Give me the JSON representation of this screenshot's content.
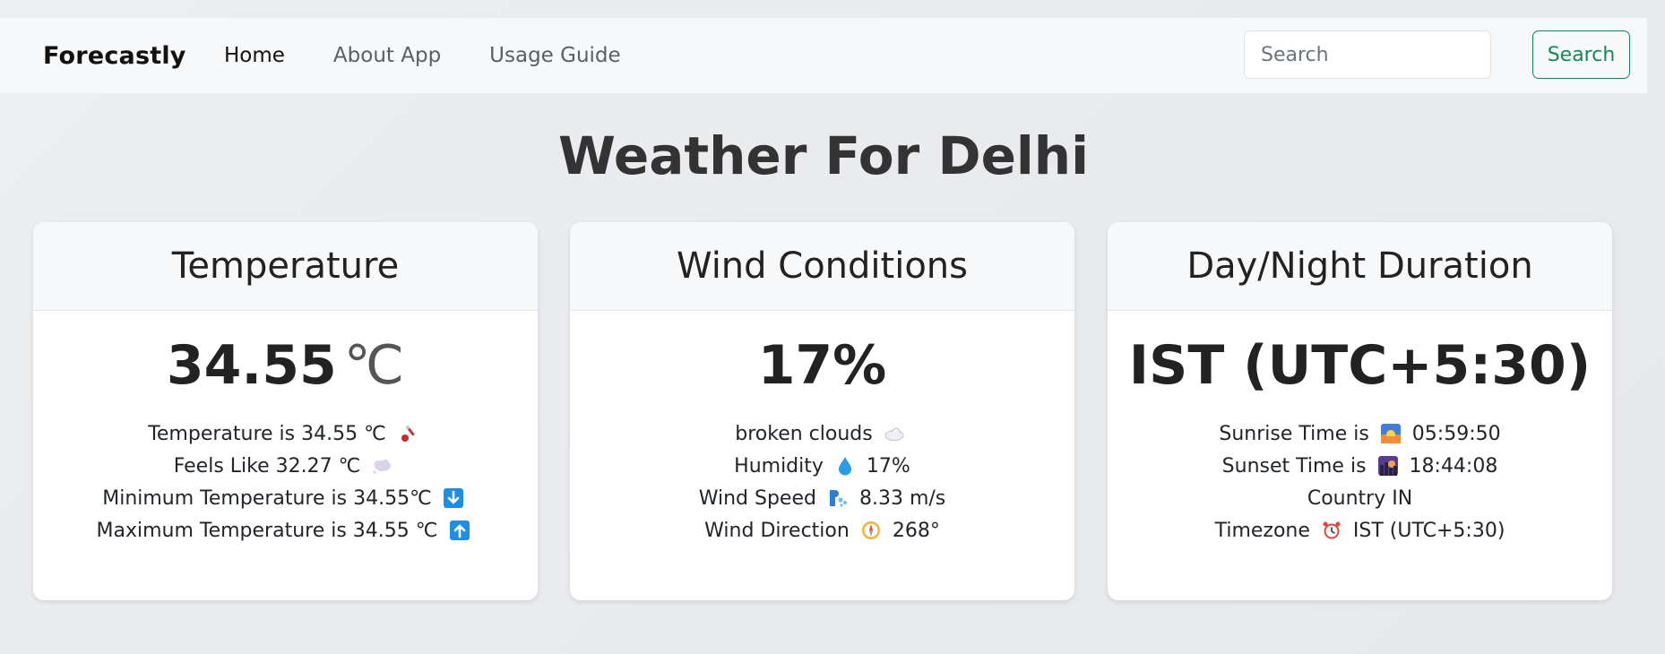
{
  "navbar": {
    "brand": "Forecastly",
    "links": [
      "Home",
      "About App",
      "Usage Guide"
    ],
    "search_placeholder": "Search",
    "search_button": "Search",
    "accent_color": "#198754"
  },
  "page_title": "Weather For Delhi",
  "cards": {
    "temperature": {
      "title": "Temperature",
      "main_value": "34.55",
      "main_unit": "℃",
      "details": [
        {
          "prefix": "Temperature is 34.55 ℃",
          "icon": "thermometer-icon",
          "suffix": ""
        },
        {
          "prefix": "Feels Like 32.27 ℃",
          "icon": "thought-cloud-icon",
          "suffix": ""
        },
        {
          "prefix": "Minimum Temperature is 34.55℃",
          "icon": "down-arrow-icon",
          "suffix": ""
        },
        {
          "prefix": "Maximum Temperature is 34.55 ℃",
          "icon": "up-arrow-icon",
          "suffix": ""
        }
      ]
    },
    "wind": {
      "title": "Wind Conditions",
      "main_value": "17%",
      "details": [
        {
          "prefix": "broken clouds",
          "icon": "cloud-icon",
          "suffix": ""
        },
        {
          "prefix": "Humidity",
          "icon": "droplet-icon",
          "suffix": "17%"
        },
        {
          "prefix": "Wind Speed",
          "icon": "wind-face-icon",
          "suffix": "8.33 m/s"
        },
        {
          "prefix": "Wind Direction",
          "icon": "compass-icon",
          "suffix": "268°"
        }
      ]
    },
    "daynight": {
      "title": "Day/Night Duration",
      "main_value": "IST (UTC+5:30)",
      "details": [
        {
          "prefix": "Sunrise Time is",
          "icon": "sunrise-icon",
          "suffix": "05:59:50"
        },
        {
          "prefix": "Sunset Time is",
          "icon": "sunset-icon",
          "suffix": "18:44:08"
        },
        {
          "prefix": "Country IN",
          "icon": "",
          "suffix": ""
        },
        {
          "prefix": "Timezone",
          "icon": "alarm-clock-icon",
          "suffix": "IST (UTC+5:30)"
        }
      ]
    }
  }
}
